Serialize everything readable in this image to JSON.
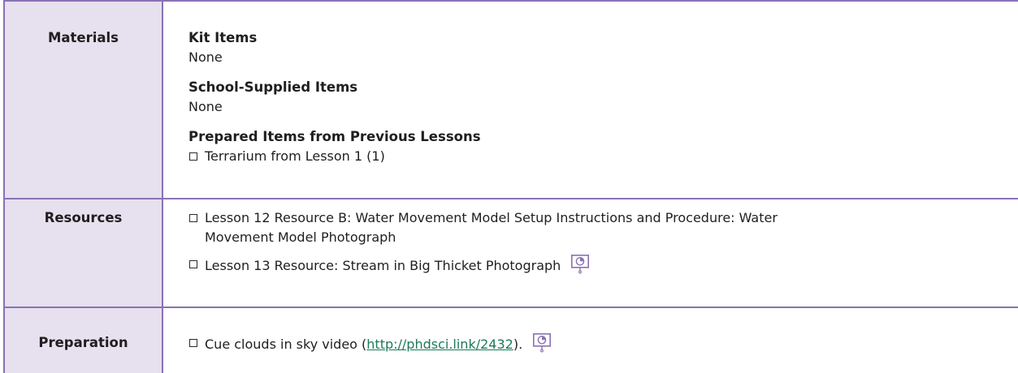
{
  "materials": {
    "label": "Materials",
    "kit_heading": "Kit Items",
    "kit_value": "None",
    "school_heading": "School-Supplied Items",
    "school_value": "None",
    "prepared_heading": "Prepared Items from Previous Lessons",
    "prepared_items": [
      "Terrarium from Lesson 1 (1)"
    ]
  },
  "resources": {
    "label": "Resources",
    "items": [
      {
        "line1": "Lesson 12 Resource B: Water Movement Model Setup Instructions and Procedure: Water",
        "line2": "Movement Model Photograph"
      },
      {
        "line1": "Lesson 13 Resource: Stream in Big Thicket Photograph"
      }
    ]
  },
  "preparation": {
    "label": "Preparation",
    "item_prefix": "Cue clouds in sky video (",
    "item_link": "http://phdsci.link/2432",
    "item_suffix": ")."
  },
  "colors": {
    "border": "#8a72b4",
    "label_bg": "#e6e0ef",
    "link": "#1b7a57"
  },
  "icons": [
    "projection-icon"
  ]
}
